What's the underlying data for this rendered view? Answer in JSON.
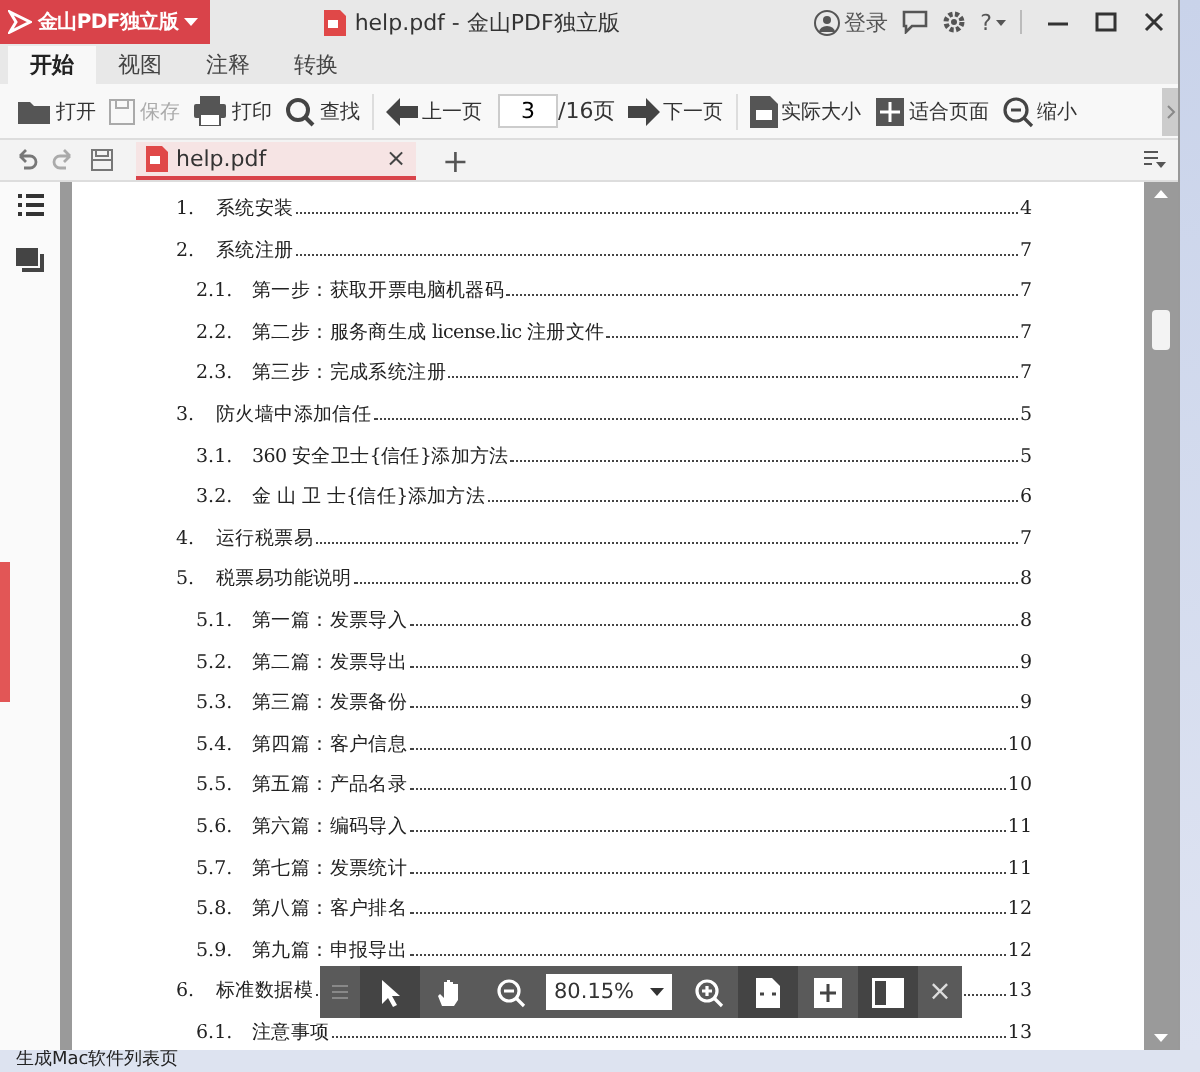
{
  "title_bar": {
    "app_button": "金山PDF独立版",
    "title": "help.pdf - 金山PDF独立版",
    "login": "登录",
    "help": "?"
  },
  "ribbon_tabs": [
    {
      "label": "开始",
      "selected": true
    },
    {
      "label": "视图",
      "selected": false
    },
    {
      "label": "注释",
      "selected": false
    },
    {
      "label": "转换",
      "selected": false
    }
  ],
  "toolbar": {
    "file_actions": [
      {
        "label": "打开",
        "disabled": false
      },
      {
        "label": "保存",
        "disabled": true
      },
      {
        "label": "打印",
        "disabled": false
      },
      {
        "label": "查找",
        "disabled": false
      }
    ],
    "page_nav": {
      "prev": "上一页",
      "page": "3",
      "total": "/16页",
      "next": "下一页"
    },
    "view_actions": [
      {
        "label": "实际大小",
        "disabled": false
      },
      {
        "label": "适合页面",
        "disabled": false
      },
      {
        "label": "缩小",
        "disabled": false
      }
    ]
  },
  "doc_tabs": [
    {
      "label": "help.pdf",
      "selected": true,
      "close": "×"
    }
  ],
  "new_tab": "+",
  "toc": [
    {
      "number": "1.",
      "title": "系统安装",
      "page": "4"
    },
    {
      "number": "2.",
      "title": "系统注册",
      "page": "7",
      "children": [
        {
          "number": "2.1.",
          "title": "第一步：获取开票电脑机器码",
          "page": "7"
        },
        {
          "number": "2.2.",
          "title": "第二步：服务商生成 license.lic 注册文件",
          "page": "7"
        },
        {
          "number": "2.3.",
          "title": "第三步：完成系统注册",
          "page": "7"
        }
      ]
    },
    {
      "number": "3.",
      "title": "防火墙中添加信任",
      "page": "5",
      "children": [
        {
          "number": "3.1.",
          "title": "360 安全卫士{信任}添加方法",
          "page": "5"
        },
        {
          "number": "3.2.",
          "title": "金 山 卫 士{信任}添加方法",
          "page": "6"
        }
      ]
    },
    {
      "number": "4.",
      "title": "运行税票易",
      "page": "7"
    },
    {
      "number": "5.",
      "title": "税票易功能说明",
      "page": "8",
      "children": [
        {
          "number": "5.1.",
          "title": "第一篇：发票导入",
          "page": "8"
        },
        {
          "number": "5.2.",
          "title": "第二篇：发票导出",
          "page": "9"
        },
        {
          "number": "5.3.",
          "title": "第三篇：发票备份",
          "page": "9"
        },
        {
          "number": "5.4.",
          "title": "第四篇：客户信息",
          "page": "10"
        },
        {
          "number": "5.5.",
          "title": "第五篇：产品名录",
          "page": "10"
        },
        {
          "number": "5.6.",
          "title": "第六篇：编码导入",
          "page": "11"
        },
        {
          "number": "5.7.",
          "title": "第七篇：发票统计",
          "page": "11"
        },
        {
          "number": "5.8.",
          "title": "第八篇：客户排名",
          "page": "12"
        },
        {
          "number": "5.9.",
          "title": "第九篇：申报导出",
          "page": "12"
        }
      ]
    },
    {
      "number": "6.",
      "title": "标准数据模",
      "page": "13",
      "children": [
        {
          "number": "6.1.",
          "title": "注意事项",
          "page": "13"
        }
      ]
    }
  ],
  "float_toolbar": {
    "zoom": "80.15%",
    "close": "×"
  },
  "background": {
    "taskbar_text": "生成Mac软件列表页"
  }
}
